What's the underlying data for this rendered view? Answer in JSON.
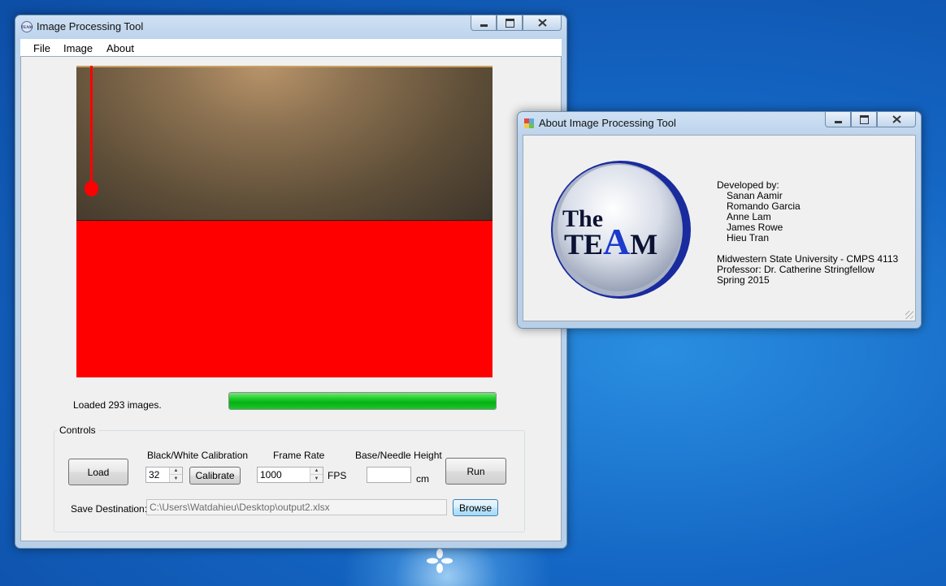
{
  "main_window": {
    "title": "Image Processing Tool",
    "menu": [
      "File",
      "Image",
      "About"
    ],
    "status_text": "Loaded 293 images.",
    "progress": 1.0,
    "controls_group_title": "Controls",
    "load_button": "Load",
    "calibration_label": "Black/White Calibration",
    "calibration_value": "32",
    "calibrate_button": "Calibrate",
    "frame_rate_label": "Frame Rate",
    "frame_rate_value": "1000",
    "fps_unit": "FPS",
    "height_label": "Base/Needle Height",
    "height_value": "",
    "height_unit": "cm",
    "run_button": "Run",
    "save_label": "Save Destination:",
    "save_path": "C:\\Users\\Watdahieu\\Desktop\\output2.xlsx",
    "browse_button": "Browse"
  },
  "about_window": {
    "title": "About Image Processing Tool",
    "logo_text_line1": "The",
    "logo_text_line2_part1": "TE",
    "logo_text_line2_part2": "A",
    "logo_text_line2_part3": "M",
    "developed_by_label": "Developed by:",
    "developers": [
      "Sanan Aamir",
      "Romando Garcia",
      "Anne Lam",
      "James Rowe",
      "Hieu Tran"
    ],
    "university": "Midwestern State University - CMPS 4113",
    "professor": "Professor: Dr. Catherine Stringfellow",
    "term": "Spring 2015"
  },
  "colors": {
    "image_fill": "#ff0000",
    "progress_fill": "#06b016",
    "desktop": "#1466c4"
  },
  "icons": {
    "app_icon": "app-icon",
    "about_icon": "about-window-icon",
    "minimize": "minimize-icon",
    "maximize": "maximize-icon",
    "close": "close-icon"
  }
}
